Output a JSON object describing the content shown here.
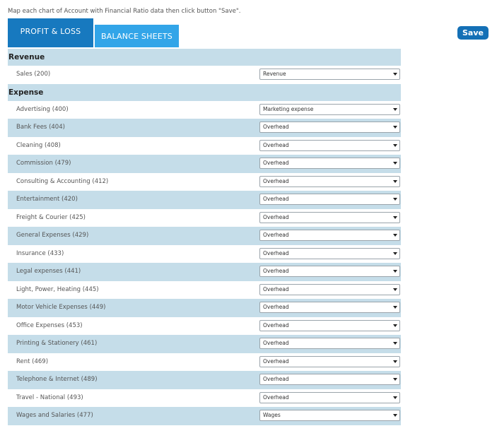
{
  "instruction": "Map each chart of Account with Financial Ratio data then click button \"Save\".",
  "tabs": [
    {
      "label": "PROFIT & LOSS",
      "active": true
    },
    {
      "label": "BALANCE SHEETS",
      "active": false
    }
  ],
  "save_label": "Save",
  "colors": {
    "tab_active": "#1779bf",
    "tab_inactive": "#32a5e8",
    "row_alt": "#c5dde9",
    "save_button": "#1470b6"
  },
  "sections": [
    {
      "title": "Revenue",
      "rows": [
        {
          "account": "Sales (200)",
          "mapping": "Revenue"
        }
      ]
    },
    {
      "title": "Expense",
      "rows": [
        {
          "account": "Advertising (400)",
          "mapping": "Marketing expense"
        },
        {
          "account": "Bank Fees (404)",
          "mapping": "Overhead"
        },
        {
          "account": "Cleaning (408)",
          "mapping": "Overhead"
        },
        {
          "account": "Commission (479)",
          "mapping": "Overhead"
        },
        {
          "account": "Consulting & Accounting (412)",
          "mapping": "Overhead"
        },
        {
          "account": "Entertainment (420)",
          "mapping": "Overhead"
        },
        {
          "account": "Freight & Courier (425)",
          "mapping": "Overhead"
        },
        {
          "account": "General Expenses (429)",
          "mapping": "Overhead"
        },
        {
          "account": "Insurance (433)",
          "mapping": "Overhead"
        },
        {
          "account": "Legal expenses (441)",
          "mapping": "Overhead"
        },
        {
          "account": "Light, Power, Heating (445)",
          "mapping": "Overhead"
        },
        {
          "account": "Motor Vehicle Expenses (449)",
          "mapping": "Overhead"
        },
        {
          "account": "Office Expenses (453)",
          "mapping": "Overhead"
        },
        {
          "account": "Printing & Stationery (461)",
          "mapping": "Overhead"
        },
        {
          "account": "Rent (469)",
          "mapping": "Overhead"
        },
        {
          "account": "Telephone & Internet (489)",
          "mapping": "Overhead"
        },
        {
          "account": "Travel - National (493)",
          "mapping": "Overhead"
        },
        {
          "account": "Wages and Salaries (477)",
          "mapping": "Wages"
        }
      ]
    }
  ]
}
